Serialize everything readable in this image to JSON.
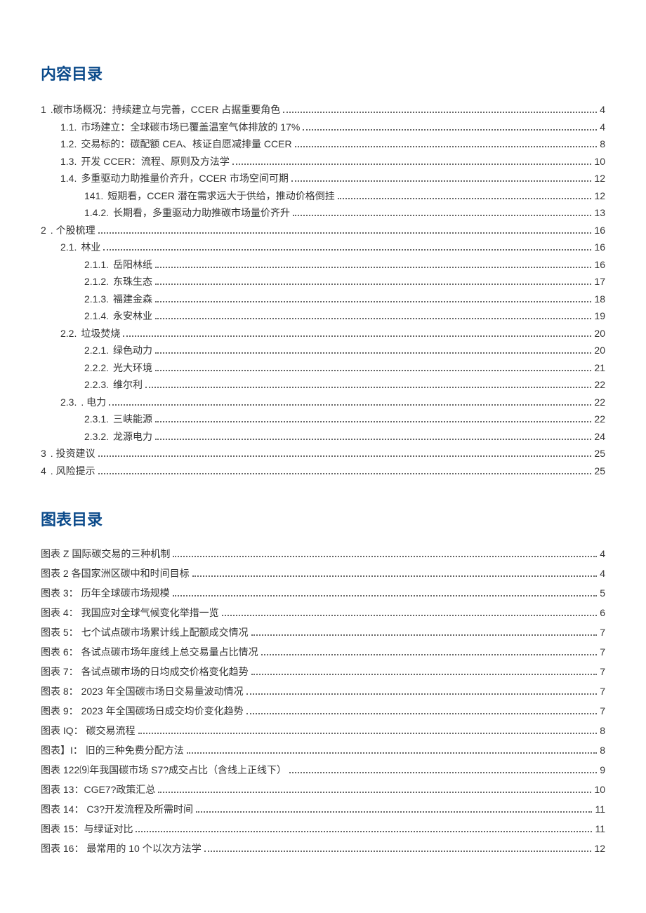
{
  "titles": {
    "contents": "内容目录",
    "figures": "图表目录"
  },
  "toc": [
    {
      "depth": 1,
      "num": "1",
      "label": " .碳市场概况：持续建立与完善，CCER 占据重要角色 ",
      "page": "4"
    },
    {
      "depth": 2,
      "num": "1.1.",
      "label": " 市场建立：全球碳市场已覆盖温室气体排放的 17% ",
      "page": "4"
    },
    {
      "depth": 2,
      "num": "1.2.",
      "label": " 交易标的：碳配额 CEA、核证自愿减排量 CCER ",
      "page": "8"
    },
    {
      "depth": 2,
      "num": "1.3.",
      "label": " 开发 CCER：流程、原则及方法学 ",
      "page": "10"
    },
    {
      "depth": 2,
      "num": "1.4.",
      "label": " 多重驱动力助推量价齐升，CCER 市场空间可期",
      "page": "12"
    },
    {
      "depth": 3,
      "num": "141.",
      "label": " 短期看，CCER 潜在需求远大于供给，推动价格倒挂 ",
      "page": "12"
    },
    {
      "depth": 3,
      "num": "1.4.2.",
      "label": " 长期看，多重驱动力助推碳市场量价齐升 ",
      "page": "13"
    },
    {
      "depth": 1,
      "num": "2",
      "label": " . 个股梳理",
      "page": "16"
    },
    {
      "depth": 2,
      "num": "2.1.",
      "label": " 林业 ",
      "page": "16"
    },
    {
      "depth": 3,
      "num": "2.1.1.",
      "label": " 岳阳林纸 ",
      "page": "16"
    },
    {
      "depth": 3,
      "num": "2.1.2.",
      "label": " 东珠生态 ",
      "page": "17"
    },
    {
      "depth": 3,
      "num": "2.1.3.",
      "label": " 福建金森 ",
      "page": "18"
    },
    {
      "depth": 3,
      "num": "2.1.4.",
      "label": " 永安林业 ",
      "page": "19"
    },
    {
      "depth": 2,
      "num": "2.2.",
      "label": " 垃圾焚烧",
      "page": "20"
    },
    {
      "depth": 3,
      "num": "2.2.1.",
      "label": " 绿色动力 ",
      "page": "20"
    },
    {
      "depth": 3,
      "num": "2.2.2.",
      "label": " 光大环境 ",
      "page": "21"
    },
    {
      "depth": 3,
      "num": "2.2.3.",
      "label": " 维尔利 ",
      "page": "22"
    },
    {
      "depth": 2,
      "num": "2.3.",
      "label": " . 电力 ",
      "page": "22"
    },
    {
      "depth": 3,
      "num": "2.3.1.",
      "label": " 三峡能源 ",
      "page": "22"
    },
    {
      "depth": 3,
      "num": "2.3.2.",
      "label": " 龙源电力 ",
      "page": "24"
    },
    {
      "depth": 1,
      "num": "3",
      "label": " . 投资建议",
      "page": "25"
    },
    {
      "depth": 1,
      "num": "4",
      "label": " . 风险提示",
      "page": "25"
    }
  ],
  "figures": [
    {
      "label": "图表 Z 国际碳交易的三种机制",
      "page": "4"
    },
    {
      "label": "图表 2 各国家洲区碳中和时间目标",
      "page": "4"
    },
    {
      "label": "图表 3：  历年全球碳市场规模",
      "page": "5"
    },
    {
      "label": "图表 4：  我国应对全球气候变化举措一览",
      "page": "6"
    },
    {
      "label": "图表 5：  七个试点碳市场累计线上配额成交情况",
      "page": "7"
    },
    {
      "label": "图表 6：  各试点碳市场年度线上总交易量占比情况",
      "page": "7"
    },
    {
      "label": "图表 7：  各试点碳市场的日均成交价格变化趋势",
      "page": "7"
    },
    {
      "label": "图表 8：  2023 年全国碳市场日交易量波动情况 ",
      "page": "7"
    },
    {
      "label": "图表 9：  2023 年全国碳场日成交均价变化趋势 ",
      "page": "7"
    },
    {
      "label": "图表 IQ：  碳交易流程",
      "page": "8"
    },
    {
      "label": "图表】I：  旧的三种免费分配方法 ",
      "page": "8"
    },
    {
      "label": "图表 122⑼年我国碳市场 S7?成交占比（含线上正线下）",
      "page": "9"
    },
    {
      "label": "图表 13：CGE7?政策汇总 ",
      "page": "10"
    },
    {
      "label": "图表 14：  C3?开发流程及所需时间 ",
      "page": "11"
    },
    {
      "label": "图表 15：与绿证对比 ",
      "page": "11"
    },
    {
      "label": "图表 16：  最常用的 10 个以次方法学 ",
      "page": "12"
    }
  ]
}
